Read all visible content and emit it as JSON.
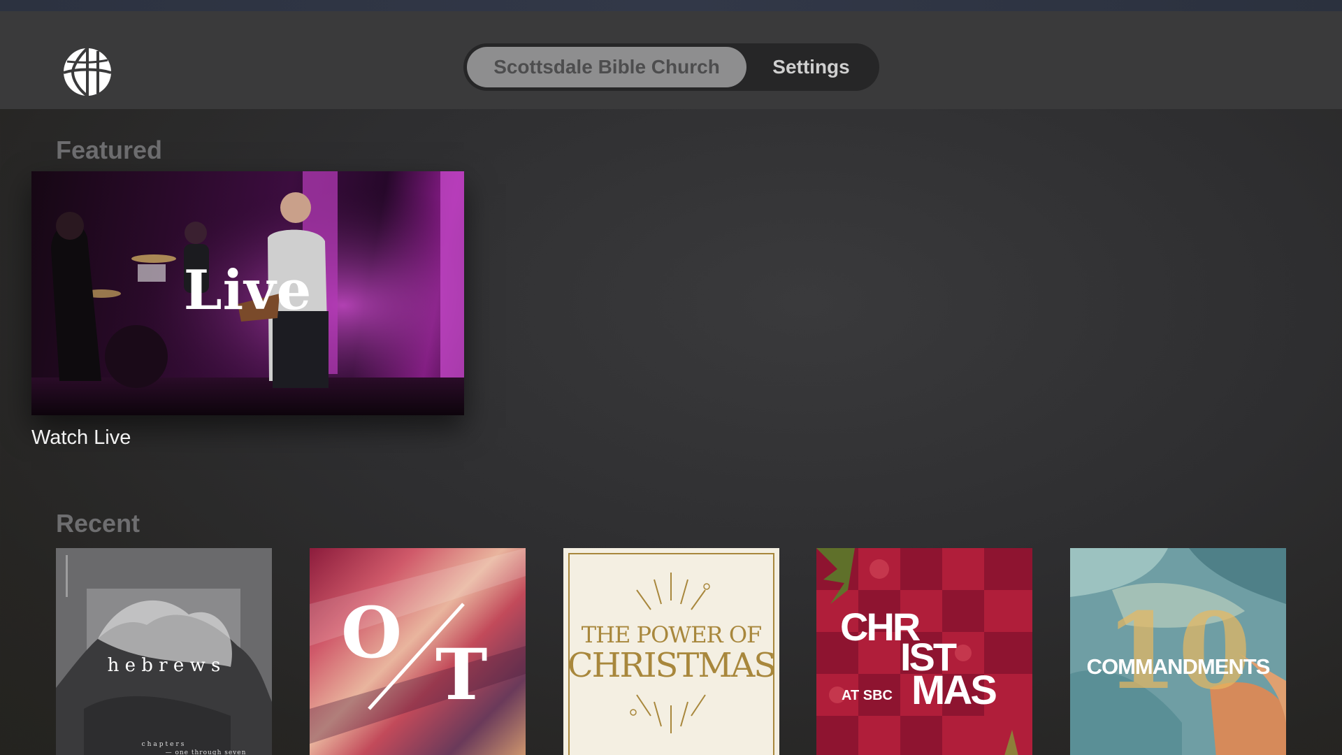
{
  "nav": {
    "tabs": [
      {
        "label": "Scottsdale Bible Church",
        "active": true
      },
      {
        "label": "Settings",
        "active": false
      }
    ]
  },
  "featured": {
    "title": "Featured",
    "items": [
      {
        "caption": "Watch Live",
        "artwork_text": "Live"
      }
    ]
  },
  "recent": {
    "title": "Recent",
    "items": [
      {
        "artwork_text": "h e b r e w s",
        "sub_line1": "chapters",
        "sub_line2": "— one through seven"
      },
      {
        "artwork_text_1": "O",
        "artwork_text_2": "T"
      },
      {
        "artwork_text_1": "THE POWER OF",
        "artwork_text_2": "CHRISTMAS"
      },
      {
        "artwork_text_1": "CHR",
        "artwork_text_2": "IST",
        "artwork_text_3": "MAS",
        "artwork_text_4": "AT SBC"
      },
      {
        "artwork_text_1": "10",
        "artwork_text_2": "COMMANDMENTS"
      }
    ]
  },
  "colors": {
    "accent_purple": "#b43cb4",
    "christmas_red": "#b01e3a",
    "gold": "#a8873c"
  }
}
